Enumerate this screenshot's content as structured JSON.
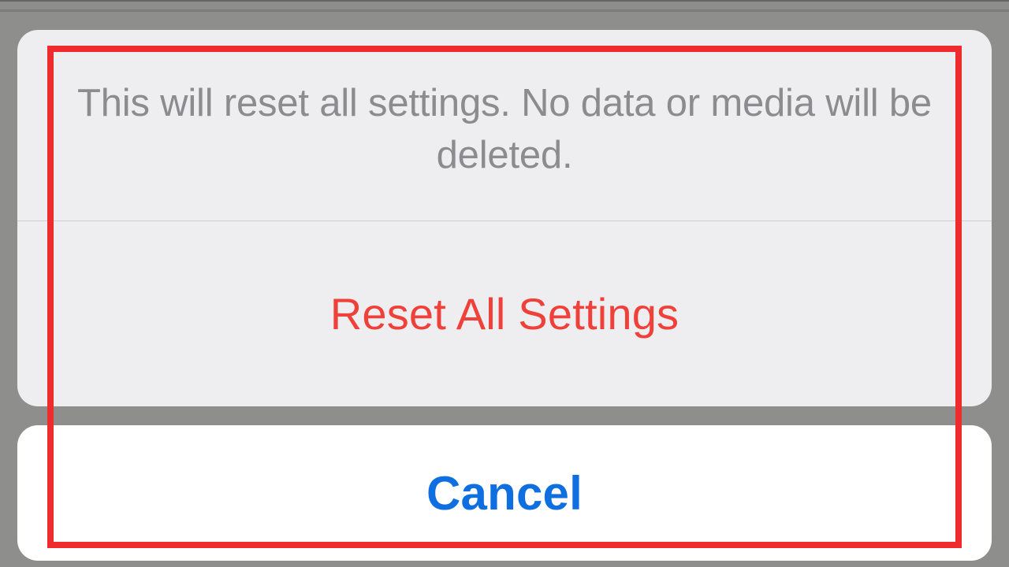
{
  "actionSheet": {
    "message": "This will reset all settings. No data or media will be deleted.",
    "destructive_label": "Reset All Settings",
    "cancel_label": "Cancel"
  }
}
